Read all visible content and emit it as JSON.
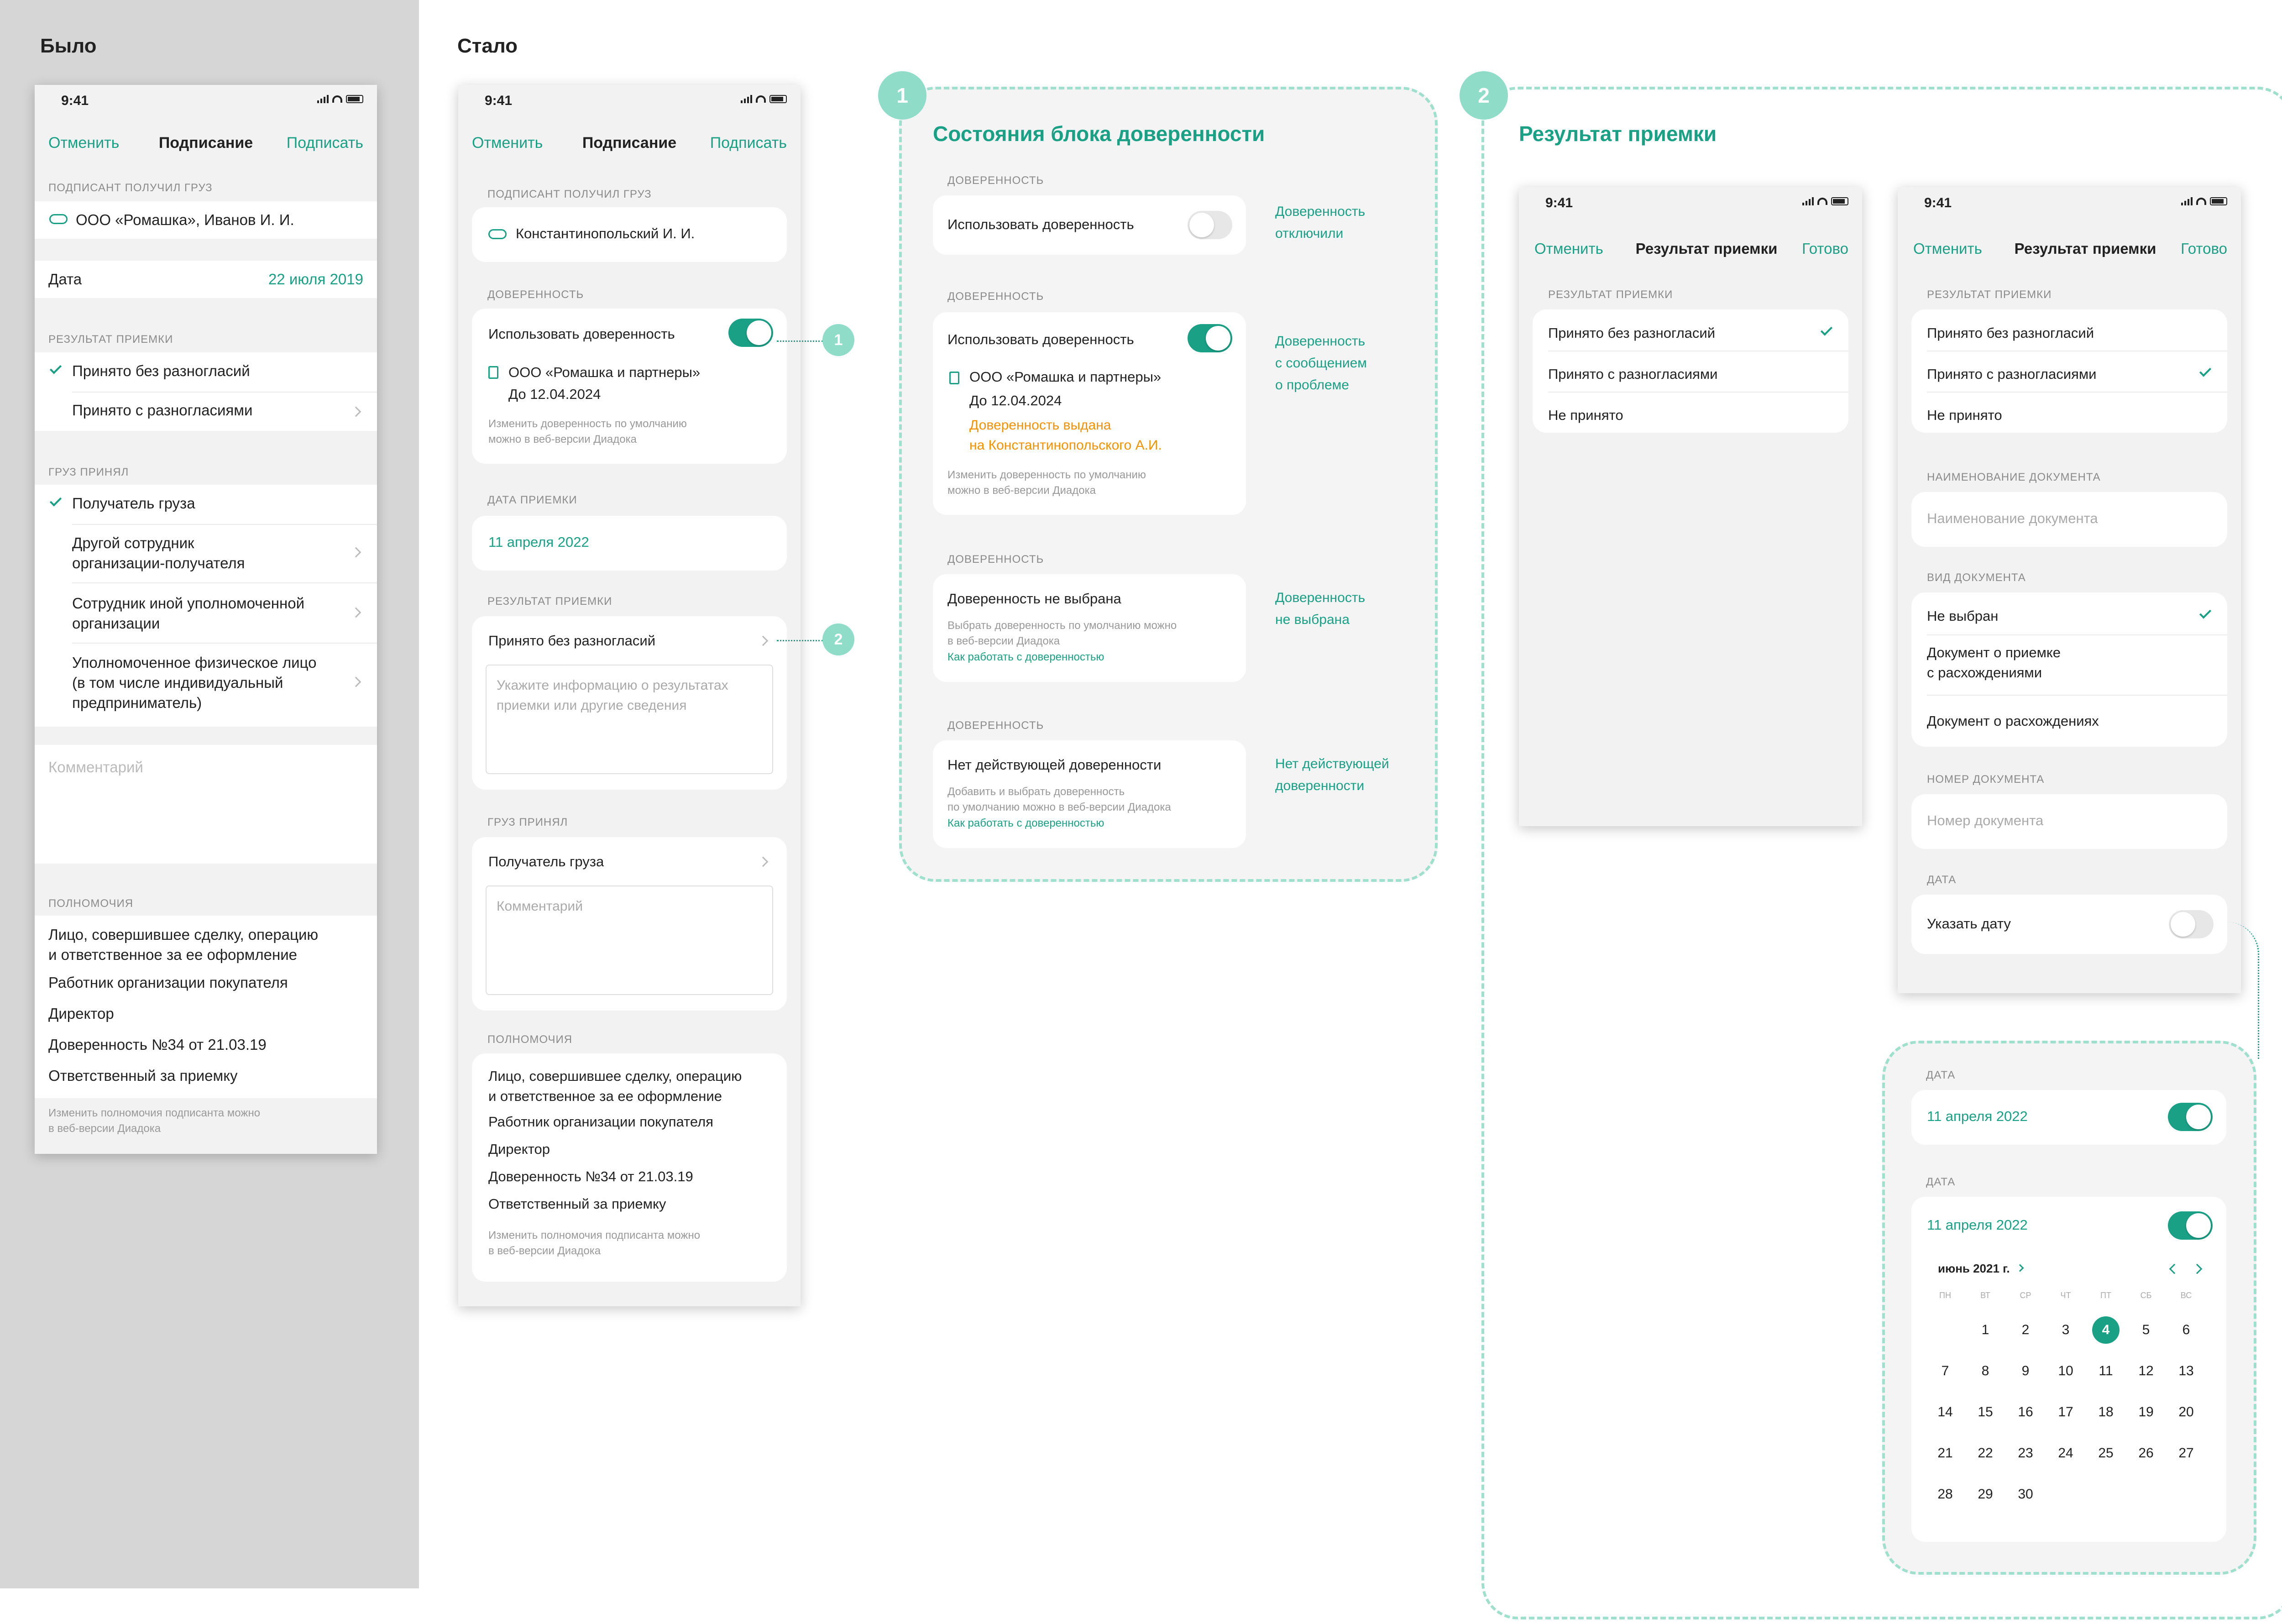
{
  "headings": {
    "before": "Было",
    "after": "Стало"
  },
  "status_time": "9:41",
  "old_screen": {
    "nav": {
      "cancel": "Отменить",
      "title": "Подписание",
      "sign": "Подписать"
    },
    "recipient_section": "ПОДПИСАНТ ПОЛУЧИЛ ГРУЗ",
    "recipient": "ООО «Ромашка», Иванов И. И.",
    "date_label": "Дата",
    "date_value": "22 июля 2019",
    "result_section": "РЕЗУЛЬТАТ ПРИЕМКИ",
    "result_items": [
      "Принято без разногласий",
      "Принято с разногласиями"
    ],
    "cargo_section": "ГРУЗ ПРИНЯЛ",
    "cargo_items": [
      "Получатель груза",
      "Другой сотрудник\nорганизации-получателя",
      "Сотрудник иной уполномоченной\nорганизации",
      "Уполномоченное физическое лицо\n(в том числе индивидуальный\nпредприниматель)"
    ],
    "comment_placeholder": "Комментарий",
    "powers_section": "ПОЛНОМОЧИЯ",
    "powers": [
      "Лицо, совершившее сделку, операцию\nи ответственное за ее оформление",
      "Работник организации покупателя",
      "Директор",
      "Доверенность №34 от 21.03.19",
      "Ответственный за приемку"
    ],
    "powers_note": "Изменить полномочия подписанта можно\nв веб-версии Диадока"
  },
  "new_screen": {
    "nav": {
      "cancel": "Отменить",
      "title": "Подписание",
      "sign": "Подписать"
    },
    "recipient_section": "ПОДПИСАНТ ПОЛУЧИЛ ГРУЗ",
    "recipient": "Константинопольский И. И.",
    "poa_section": "ДОВЕРЕННОСТЬ",
    "poa_toggle_label": "Использовать доверенность",
    "poa_org": "ООО «Ромашка и партнеры»",
    "poa_until": "До 12.04.2024",
    "poa_note": "Изменить доверенность по умолчанию\nможно в веб-версии Диадока",
    "date_section": "ДАТА ПРИЕМКИ",
    "date_value": "11 апреля 2022",
    "result_section": "РЕЗУЛЬТАТ ПРИЕМКИ",
    "result_value": "Принято без разногласий",
    "result_placeholder": "Укажите информацию о результатах\nприемки или другие сведения",
    "cargo_section": "ГРУЗ ПРИНЯЛ",
    "cargo_value": "Получатель груза",
    "comment_placeholder": "Комментарий",
    "powers_section": "ПОЛНОМОЧИЯ",
    "powers": [
      "Лицо, совершившее сделку, операцию\nи ответственное за ее оформление",
      "Работник организации покупателя",
      "Директор",
      "Доверенность №34 от 21.03.19",
      "Ответственный за приемку"
    ],
    "powers_note": "Изменить полномочия подписанта можно\nв веб-версии Диадока",
    "markers": [
      "1",
      "2"
    ]
  },
  "states_panel": {
    "badge": "1",
    "title": "Состояния блока доверенности",
    "section": "ДОВЕРЕННОСТЬ",
    "state1": {
      "label": "Использовать доверенность",
      "caption": "Доверенность\nотключили"
    },
    "state2": {
      "label": "Использовать доверенность",
      "org": "ООО «Ромашка и партнеры»",
      "until": "До 12.04.2024",
      "warning": "Доверенность выдана\nна Константинопольского А.И.",
      "note": "Изменить доверенность по умолчанию\nможно в веб-версии Диадока",
      "caption": "Доверенность\nс сообщением\nо проблеме"
    },
    "state3": {
      "label": "Доверенность не выбрана",
      "note": "Выбрать доверенность по умолчанию можно\nв веб-версии Диадока",
      "link": "Как работать с доверенностью",
      "caption": "Доверенность\nне выбрана"
    },
    "state4": {
      "label": "Нет действующей доверенности",
      "note": "Добавить и выбрать доверенность\nпо умолчанию можно в веб-версии Диадока",
      "link": "Как работать с доверенностью",
      "caption": "Нет действующей\nдоверенности"
    }
  },
  "result_panel": {
    "badge": "2",
    "title": "Результат приемки",
    "screen_a": {
      "nav": {
        "cancel": "Отменить",
        "title": "Результат приемки",
        "done": "Готово"
      },
      "section": "РЕЗУЛЬТАТ ПРИЕМКИ",
      "items": [
        "Принято без разногласий",
        "Принято с разногласиями",
        "Не принято"
      ],
      "selected": 0
    },
    "screen_b": {
      "nav": {
        "cancel": "Отменить",
        "title": "Результат приемки",
        "done": "Готово"
      },
      "section": "РЕЗУЛЬТАТ ПРИЕМКИ",
      "items": [
        "Принято без разногласий",
        "Принято с разногласиями",
        "Не принято"
      ],
      "selected": 1,
      "doc_name_section": "НАИМЕНОВАНИЕ ДОКУМЕНТА",
      "doc_name_placeholder": "Наименование документа",
      "doc_type_section": "ВИД ДОКУМЕНТА",
      "doc_types": [
        "Не выбран",
        "Документ о приемке\nс расхождениями",
        "Документ о расхождениях"
      ],
      "doc_number_section": "НОМЕР ДОКУМЕНТА",
      "doc_number_placeholder": "Номер документа",
      "date_section": "ДАТА",
      "date_toggle_label": "Указать дату"
    },
    "date_block": {
      "section": "ДАТА",
      "date_value": "11 апреля 2022"
    },
    "calendar": {
      "section": "ДАТА",
      "date_value": "11 апреля 2022",
      "month": "июнь 2021 г.",
      "weekdays": [
        "ПН",
        "ВТ",
        "СР",
        "ЧТ",
        "ПТ",
        "СБ",
        "ВС"
      ],
      "selected_day": "4",
      "weeks": [
        [
          "",
          "1",
          "2",
          "3",
          "4",
          "5",
          "6"
        ],
        [
          "7",
          "8",
          "9",
          "10",
          "11",
          "12",
          "13"
        ],
        [
          "14",
          "15",
          "16",
          "17",
          "18",
          "19",
          "20"
        ],
        [
          "21",
          "22",
          "23",
          "24",
          "25",
          "26",
          "27"
        ],
        [
          "28",
          "29",
          "30",
          "",
          "",
          "",
          ""
        ]
      ]
    }
  },
  "colors": {
    "accent": "#1aa085",
    "badge": "#8fdcc8",
    "warning": "#f29200"
  }
}
